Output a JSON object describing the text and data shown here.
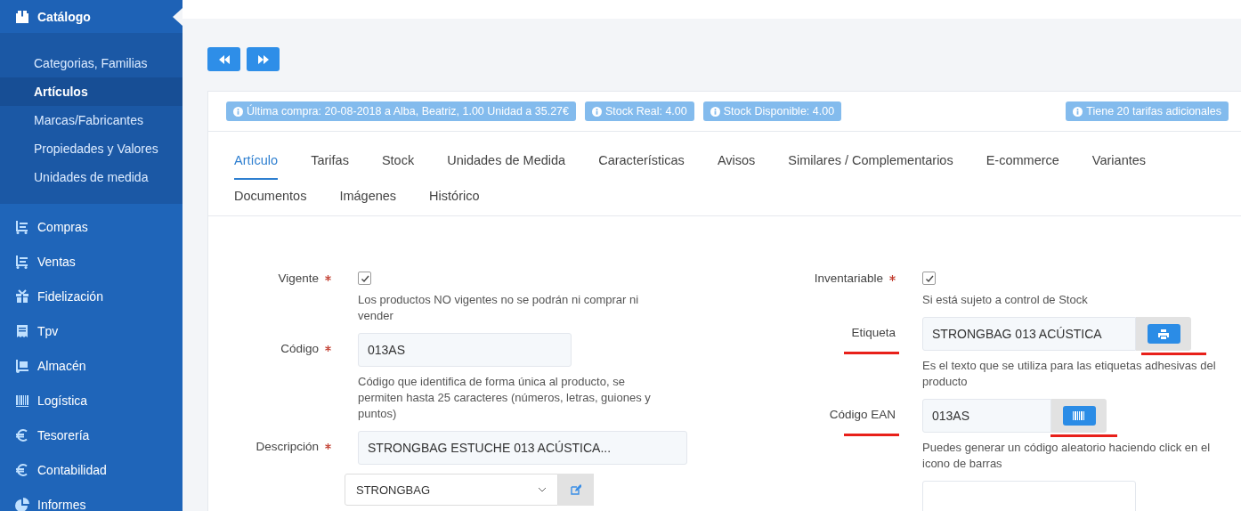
{
  "sidebar": {
    "items": [
      {
        "label": "Catálogo",
        "expanded": true,
        "children": [
          {
            "label": "Categorias, Familias",
            "selected": false
          },
          {
            "label": "Artículos",
            "selected": true
          },
          {
            "label": "Marcas/Fabricantes",
            "selected": false
          },
          {
            "label": "Propiedades y Valores",
            "selected": false
          },
          {
            "label": "Unidades de medida",
            "selected": false
          }
        ]
      },
      {
        "label": "Compras",
        "expanded": false
      },
      {
        "label": "Ventas",
        "expanded": false
      },
      {
        "label": "Fidelización",
        "expanded": false
      },
      {
        "label": "Tpv",
        "expanded": false
      },
      {
        "label": "Almacén",
        "expanded": false
      },
      {
        "label": "Logística",
        "expanded": false
      },
      {
        "label": "Tesorería",
        "expanded": false
      },
      {
        "label": "Contabilidad",
        "expanded": false
      },
      {
        "label": "Informes",
        "expanded": false
      }
    ]
  },
  "info_badges": [
    "Última compra: 20-08-2018 a Alba, Beatriz, 1.00 Unidad a 35.27€",
    "Stock Real: 4.00",
    "Stock Disponible: 4.00"
  ],
  "info_badge_right": "Tiene 20 tarifas adicionales",
  "tabs": [
    {
      "label": "Artículo",
      "selected": true
    },
    {
      "label": "Tarifas",
      "selected": false
    },
    {
      "label": "Stock",
      "selected": false
    },
    {
      "label": "Unidades de Medida",
      "selected": false
    },
    {
      "label": "Características",
      "selected": false
    },
    {
      "label": "Avisos",
      "selected": false
    },
    {
      "label": "Similares / Complementarios",
      "selected": false
    },
    {
      "label": "E-commerce",
      "selected": false
    },
    {
      "label": "Variantes",
      "selected": false
    },
    {
      "label": "Documentos",
      "selected": false
    },
    {
      "label": "Imágenes",
      "selected": false
    },
    {
      "label": "Histórico",
      "selected": false
    }
  ],
  "form_left": [
    {
      "kind": "checkbox",
      "label": "Vigente",
      "required": true,
      "checked": true,
      "help": "Los productos NO vigentes no se podrán ni comprar ni vender"
    },
    {
      "kind": "input",
      "label": "Código",
      "required": true,
      "value": "013AS",
      "help": "Código que identifica de forma única al producto, se permiten hasta 25 caracteres (números, letras, guiones y puntos)"
    },
    {
      "kind": "input",
      "label": "Descripción",
      "required": true,
      "value": "STRONGBAG ESTUCHE 013 ACÚSTICA..."
    },
    {
      "kind": "select",
      "value": "STRONGBAG"
    }
  ],
  "form_right": [
    {
      "kind": "checkbox",
      "label": "Inventariable",
      "required": true,
      "checked": true,
      "help": "Si está sujeto a control de Stock"
    },
    {
      "kind": "print",
      "label": "Etiqueta",
      "required": false,
      "underlined": true,
      "value": "STRONGBAG 013 ACÚSTICA",
      "help": "Es el texto que se utiliza para las etiquetas adhesivas del producto"
    },
    {
      "kind": "barcode",
      "label": "Código EAN",
      "required": false,
      "underlined": true,
      "value": "013AS",
      "help": "Puedes generar un código aleatorio haciendo click en el icono de barras"
    },
    {
      "kind": "input"
    }
  ]
}
